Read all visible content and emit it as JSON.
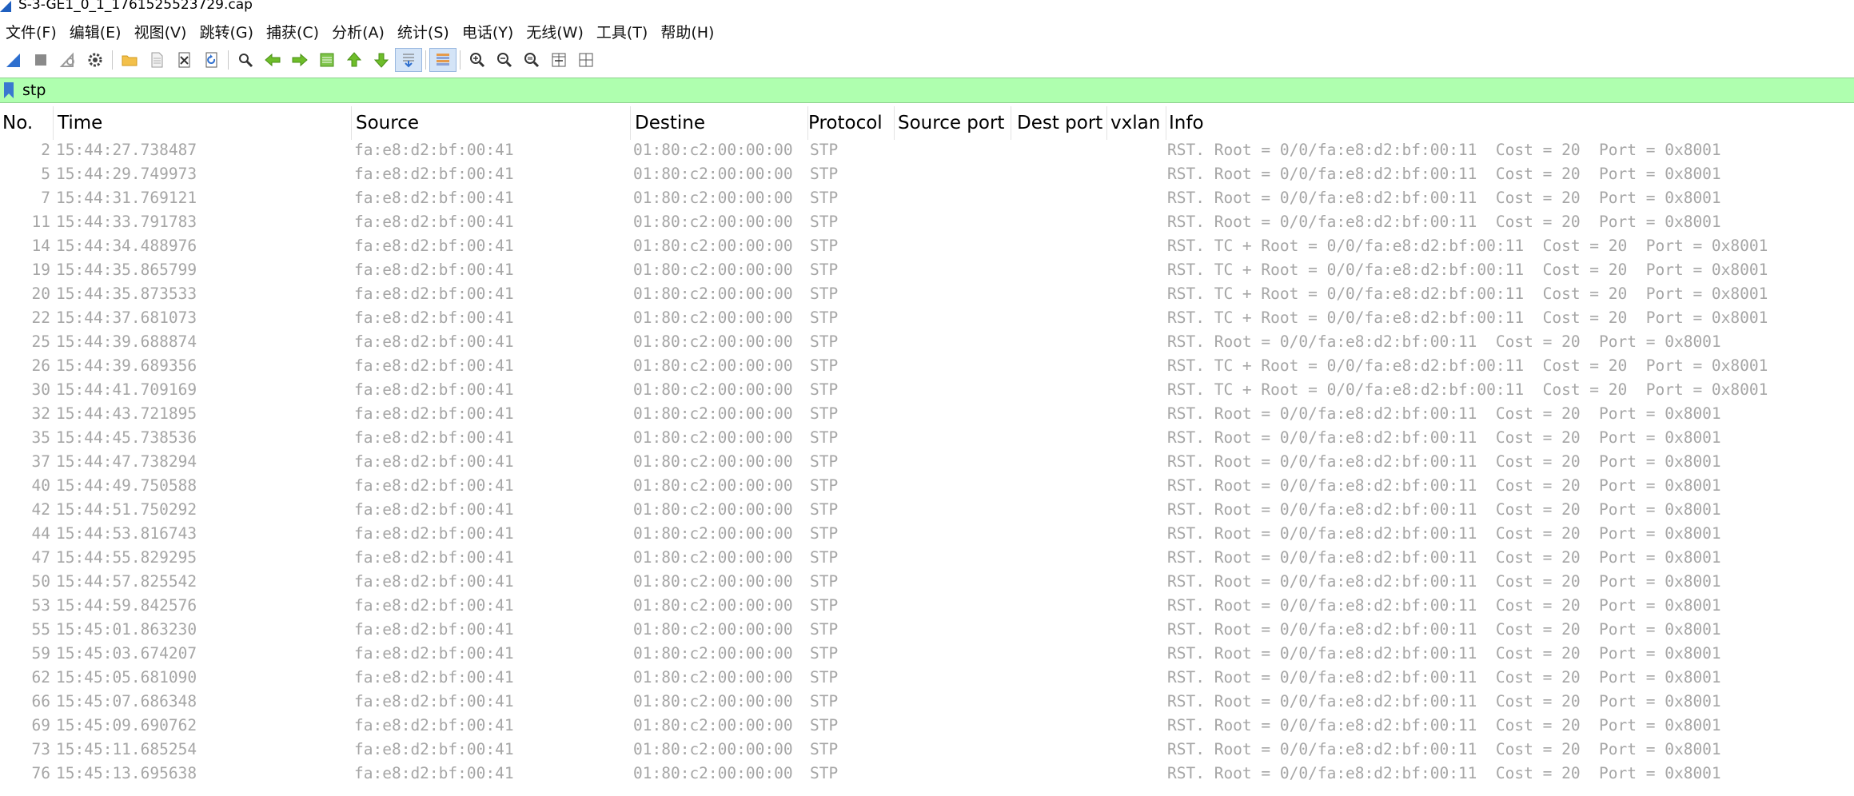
{
  "window": {
    "title": "S-3-GE1_0_1_1761525523729.cap"
  },
  "menu": [
    "文件(F)",
    "编辑(E)",
    "视图(V)",
    "跳转(G)",
    "捕获(C)",
    "分析(A)",
    "统计(S)",
    "电话(Y)",
    "无线(W)",
    "工具(T)",
    "帮助(H)"
  ],
  "toolbar": {
    "icons": [
      "shark-fin-start-icon",
      "stop-icon",
      "restart-icon",
      "capture-options-gear-icon",
      "open-folder-icon",
      "file-icon",
      "close-file-icon",
      "reload-icon",
      "find-icon",
      "go-back-arrow-icon",
      "go-forward-arrow-icon",
      "go-to-packet-icon",
      "first-packet-icon",
      "last-packet-icon",
      "autoscroll-icon",
      "colorize-icon",
      "zoom-in-icon",
      "zoom-out-icon",
      "normal-size-icon",
      "resize-columns-icon",
      "layout-icon"
    ]
  },
  "filter": {
    "value": "stp"
  },
  "columns": [
    "No.",
    "Time",
    "Source",
    "Destine",
    "Protocol",
    "Source port",
    "Dest port",
    "vxlan",
    "Info"
  ],
  "packets": [
    {
      "no": "2",
      "time": "15:44:27.738487",
      "source": "fa:e8:d2:bf:00:41",
      "dest": "01:80:c2:00:00:00",
      "protocol": "STP",
      "info": "RST. Root = 0/0/fa:e8:d2:bf:00:11  Cost = 20  Port = 0x8001"
    },
    {
      "no": "5",
      "time": "15:44:29.749973",
      "source": "fa:e8:d2:bf:00:41",
      "dest": "01:80:c2:00:00:00",
      "protocol": "STP",
      "info": "RST. Root = 0/0/fa:e8:d2:bf:00:11  Cost = 20  Port = 0x8001"
    },
    {
      "no": "7",
      "time": "15:44:31.769121",
      "source": "fa:e8:d2:bf:00:41",
      "dest": "01:80:c2:00:00:00",
      "protocol": "STP",
      "info": "RST. Root = 0/0/fa:e8:d2:bf:00:11  Cost = 20  Port = 0x8001"
    },
    {
      "no": "11",
      "time": "15:44:33.791783",
      "source": "fa:e8:d2:bf:00:41",
      "dest": "01:80:c2:00:00:00",
      "protocol": "STP",
      "info": "RST. Root = 0/0/fa:e8:d2:bf:00:11  Cost = 20  Port = 0x8001"
    },
    {
      "no": "14",
      "time": "15:44:34.488976",
      "source": "fa:e8:d2:bf:00:41",
      "dest": "01:80:c2:00:00:00",
      "protocol": "STP",
      "info": "RST. TC + Root = 0/0/fa:e8:d2:bf:00:11  Cost = 20  Port = 0x8001"
    },
    {
      "no": "19",
      "time": "15:44:35.865799",
      "source": "fa:e8:d2:bf:00:41",
      "dest": "01:80:c2:00:00:00",
      "protocol": "STP",
      "info": "RST. TC + Root = 0/0/fa:e8:d2:bf:00:11  Cost = 20  Port = 0x8001"
    },
    {
      "no": "20",
      "time": "15:44:35.873533",
      "source": "fa:e8:d2:bf:00:41",
      "dest": "01:80:c2:00:00:00",
      "protocol": "STP",
      "info": "RST. TC + Root = 0/0/fa:e8:d2:bf:00:11  Cost = 20  Port = 0x8001"
    },
    {
      "no": "22",
      "time": "15:44:37.681073",
      "source": "fa:e8:d2:bf:00:41",
      "dest": "01:80:c2:00:00:00",
      "protocol": "STP",
      "info": "RST. TC + Root = 0/0/fa:e8:d2:bf:00:11  Cost = 20  Port = 0x8001"
    },
    {
      "no": "25",
      "time": "15:44:39.688874",
      "source": "fa:e8:d2:bf:00:41",
      "dest": "01:80:c2:00:00:00",
      "protocol": "STP",
      "info": "RST. Root = 0/0/fa:e8:d2:bf:00:11  Cost = 20  Port = 0x8001"
    },
    {
      "no": "26",
      "time": "15:44:39.689356",
      "source": "fa:e8:d2:bf:00:41",
      "dest": "01:80:c2:00:00:00",
      "protocol": "STP",
      "info": "RST. TC + Root = 0/0/fa:e8:d2:bf:00:11  Cost = 20  Port = 0x8001"
    },
    {
      "no": "30",
      "time": "15:44:41.709169",
      "source": "fa:e8:d2:bf:00:41",
      "dest": "01:80:c2:00:00:00",
      "protocol": "STP",
      "info": "RST. TC + Root = 0/0/fa:e8:d2:bf:00:11  Cost = 20  Port = 0x8001"
    },
    {
      "no": "32",
      "time": "15:44:43.721895",
      "source": "fa:e8:d2:bf:00:41",
      "dest": "01:80:c2:00:00:00",
      "protocol": "STP",
      "info": "RST. Root = 0/0/fa:e8:d2:bf:00:11  Cost = 20  Port = 0x8001"
    },
    {
      "no": "35",
      "time": "15:44:45.738536",
      "source": "fa:e8:d2:bf:00:41",
      "dest": "01:80:c2:00:00:00",
      "protocol": "STP",
      "info": "RST. Root = 0/0/fa:e8:d2:bf:00:11  Cost = 20  Port = 0x8001"
    },
    {
      "no": "37",
      "time": "15:44:47.738294",
      "source": "fa:e8:d2:bf:00:41",
      "dest": "01:80:c2:00:00:00",
      "protocol": "STP",
      "info": "RST. Root = 0/0/fa:e8:d2:bf:00:11  Cost = 20  Port = 0x8001"
    },
    {
      "no": "40",
      "time": "15:44:49.750588",
      "source": "fa:e8:d2:bf:00:41",
      "dest": "01:80:c2:00:00:00",
      "protocol": "STP",
      "info": "RST. Root = 0/0/fa:e8:d2:bf:00:11  Cost = 20  Port = 0x8001"
    },
    {
      "no": "42",
      "time": "15:44:51.750292",
      "source": "fa:e8:d2:bf:00:41",
      "dest": "01:80:c2:00:00:00",
      "protocol": "STP",
      "info": "RST. Root = 0/0/fa:e8:d2:bf:00:11  Cost = 20  Port = 0x8001"
    },
    {
      "no": "44",
      "time": "15:44:53.816743",
      "source": "fa:e8:d2:bf:00:41",
      "dest": "01:80:c2:00:00:00",
      "protocol": "STP",
      "info": "RST. Root = 0/0/fa:e8:d2:bf:00:11  Cost = 20  Port = 0x8001"
    },
    {
      "no": "47",
      "time": "15:44:55.829295",
      "source": "fa:e8:d2:bf:00:41",
      "dest": "01:80:c2:00:00:00",
      "protocol": "STP",
      "info": "RST. Root = 0/0/fa:e8:d2:bf:00:11  Cost = 20  Port = 0x8001"
    },
    {
      "no": "50",
      "time": "15:44:57.825542",
      "source": "fa:e8:d2:bf:00:41",
      "dest": "01:80:c2:00:00:00",
      "protocol": "STP",
      "info": "RST. Root = 0/0/fa:e8:d2:bf:00:11  Cost = 20  Port = 0x8001"
    },
    {
      "no": "53",
      "time": "15:44:59.842576",
      "source": "fa:e8:d2:bf:00:41",
      "dest": "01:80:c2:00:00:00",
      "protocol": "STP",
      "info": "RST. Root = 0/0/fa:e8:d2:bf:00:11  Cost = 20  Port = 0x8001"
    },
    {
      "no": "55",
      "time": "15:45:01.863230",
      "source": "fa:e8:d2:bf:00:41",
      "dest": "01:80:c2:00:00:00",
      "protocol": "STP",
      "info": "RST. Root = 0/0/fa:e8:d2:bf:00:11  Cost = 20  Port = 0x8001"
    },
    {
      "no": "59",
      "time": "15:45:03.674207",
      "source": "fa:e8:d2:bf:00:41",
      "dest": "01:80:c2:00:00:00",
      "protocol": "STP",
      "info": "RST. Root = 0/0/fa:e8:d2:bf:00:11  Cost = 20  Port = 0x8001"
    },
    {
      "no": "62",
      "time": "15:45:05.681090",
      "source": "fa:e8:d2:bf:00:41",
      "dest": "01:80:c2:00:00:00",
      "protocol": "STP",
      "info": "RST. Root = 0/0/fa:e8:d2:bf:00:11  Cost = 20  Port = 0x8001"
    },
    {
      "no": "66",
      "time": "15:45:07.686348",
      "source": "fa:e8:d2:bf:00:41",
      "dest": "01:80:c2:00:00:00",
      "protocol": "STP",
      "info": "RST. Root = 0/0/fa:e8:d2:bf:00:11  Cost = 20  Port = 0x8001"
    },
    {
      "no": "69",
      "time": "15:45:09.690762",
      "source": "fa:e8:d2:bf:00:41",
      "dest": "01:80:c2:00:00:00",
      "protocol": "STP",
      "info": "RST. Root = 0/0/fa:e8:d2:bf:00:11  Cost = 20  Port = 0x8001"
    },
    {
      "no": "73",
      "time": "15:45:11.685254",
      "source": "fa:e8:d2:bf:00:41",
      "dest": "01:80:c2:00:00:00",
      "protocol": "STP",
      "info": "RST. Root = 0/0/fa:e8:d2:bf:00:11  Cost = 20  Port = 0x8001"
    },
    {
      "no": "76",
      "time": "15:45:13.695638",
      "source": "fa:e8:d2:bf:00:41",
      "dest": "01:80:c2:00:00:00",
      "protocol": "STP",
      "info": "RST. Root = 0/0/fa:e8:d2:bf:00:11  Cost = 20  Port = 0x8001"
    }
  ],
  "colors": {
    "filter_valid_bg": "#afffaf",
    "row_text": "#a6a6a6",
    "accent_blue": "#1f5fbf"
  }
}
